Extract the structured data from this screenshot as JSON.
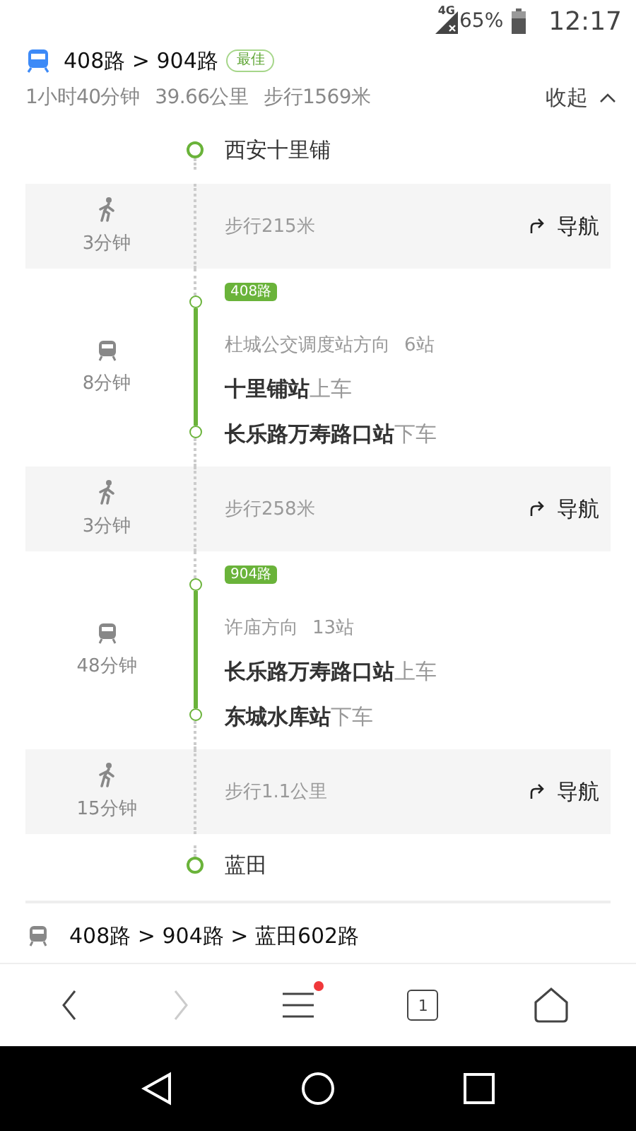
{
  "status_bar": {
    "network": "4G",
    "battery": "65%",
    "time": "12:17"
  },
  "route": {
    "title": "408路 > 904路",
    "badge": "最佳",
    "summary": [
      "1小时40分钟",
      "39.66公里",
      "步行1569米"
    ],
    "collapse": "收起"
  },
  "steps": [
    {
      "kind": "stop",
      "name": "西安十里铺"
    },
    {
      "kind": "walk",
      "duration": "3分钟",
      "distance": "步行215米",
      "nav": "导航"
    },
    {
      "kind": "bus",
      "duration": "8分钟",
      "line": "408路",
      "direction": "杜城公交调度站方向",
      "stops": "6站",
      "board": {
        "name": "十里铺站",
        "action": "上车"
      },
      "alight": {
        "name": "长乐路万寿路口站",
        "action": "下车"
      }
    },
    {
      "kind": "walk",
      "duration": "3分钟",
      "distance": "步行258米",
      "nav": "导航"
    },
    {
      "kind": "bus",
      "duration": "48分钟",
      "line": "904路",
      "direction": "许庙方向",
      "stops": "13站",
      "board": {
        "name": "长乐路万寿路口站",
        "action": "上车"
      },
      "alight": {
        "name": "东城水库站",
        "action": "下车"
      }
    },
    {
      "kind": "walk",
      "duration": "15分钟",
      "distance": "步行1.1公里",
      "nav": "导航"
    },
    {
      "kind": "stop",
      "name": "蓝田"
    }
  ],
  "next_route": {
    "title": "408路 > 904路 > 蓝田602路"
  },
  "browser_bar": {
    "back_disabled": false,
    "forward_disabled": true,
    "menu_badge": true,
    "tab_count": "1"
  }
}
